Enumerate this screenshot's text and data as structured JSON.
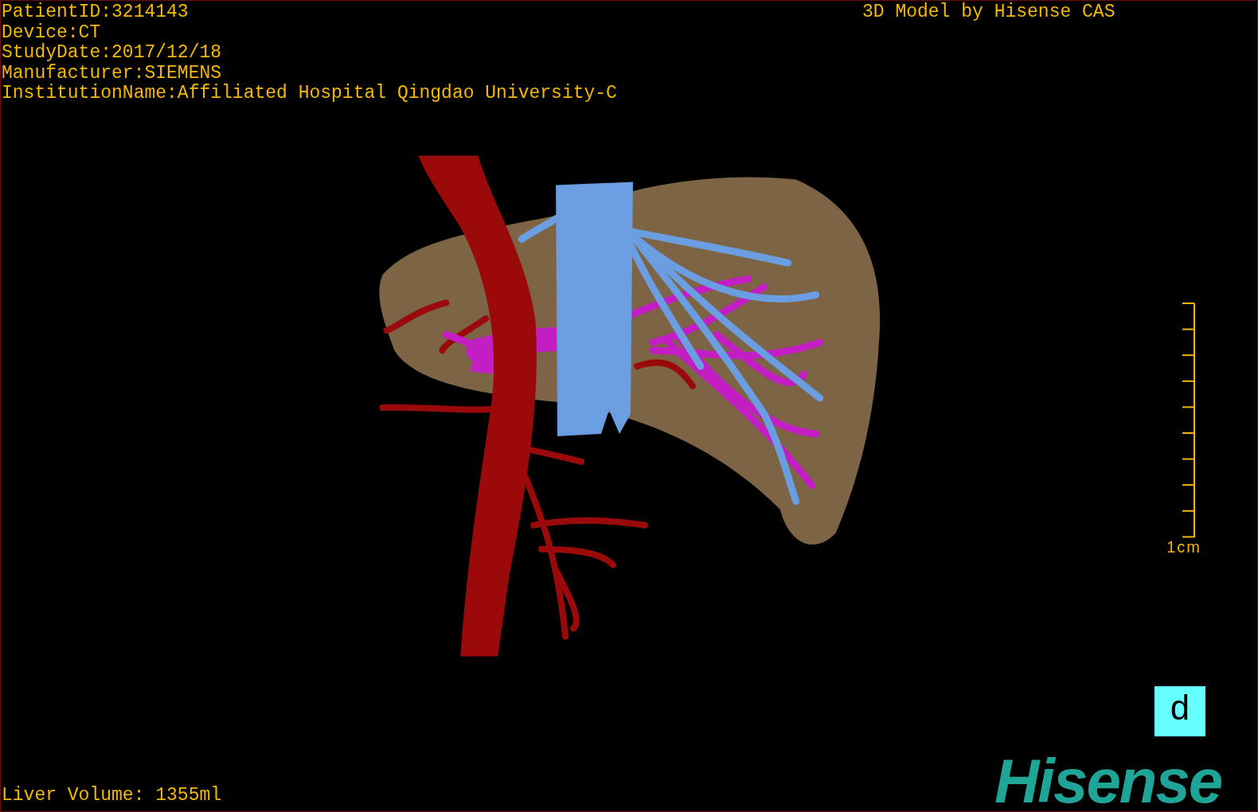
{
  "patient_info": [
    "PatientID:3214143",
    "Device:CT",
    "StudyDate:2017/12/18",
    "Manufacturer:SIEMENS",
    "InstitutionName:Affiliated Hospital Qingdao University-C"
  ],
  "model_credit": "3D Model by Hisense CAS",
  "scale_bar": {
    "label": "1cm"
  },
  "orientation_marker": {
    "label": "d"
  },
  "liver_volume": "Liver Volume: 1355ml",
  "logo": "Hisense"
}
